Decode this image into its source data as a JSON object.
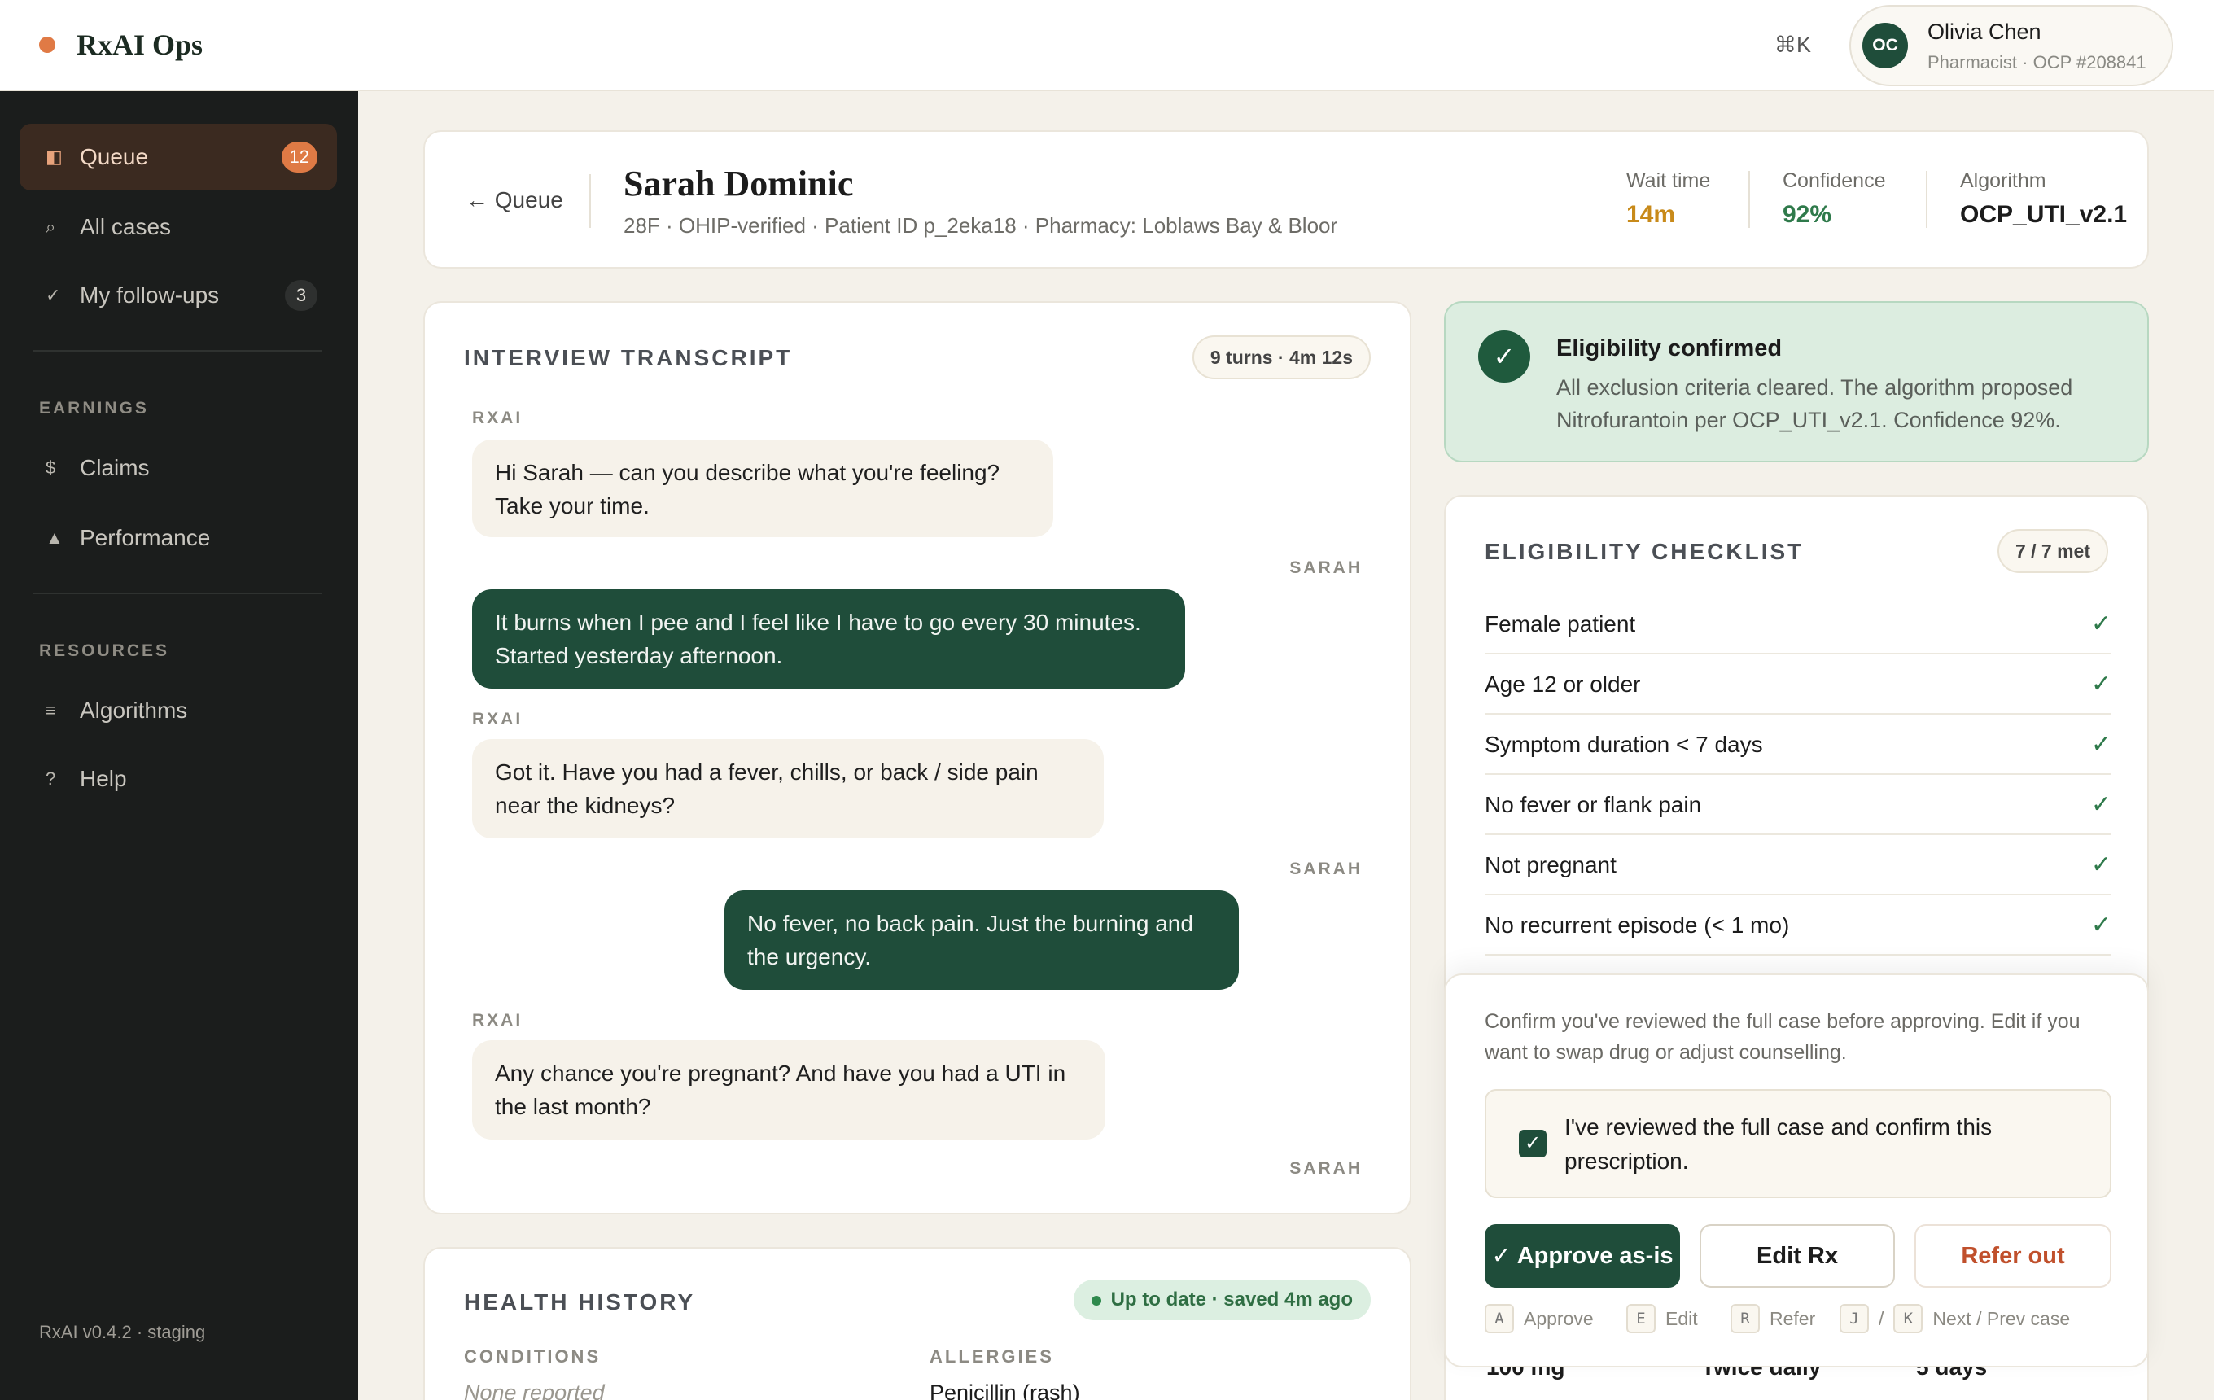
{
  "brand": {
    "name": "RxAI Ops"
  },
  "topbar": {
    "shortcut": "⌘K"
  },
  "user": {
    "initials": "OC",
    "name": "Olivia Chen",
    "role": "Pharmacist · OCP #208841"
  },
  "sidebar": {
    "items": [
      {
        "label": "Queue",
        "icon": "◧",
        "count": "12"
      },
      {
        "label": "All cases",
        "icon": "⌕"
      },
      {
        "label": "My follow-ups",
        "icon": "✓",
        "count": "3"
      }
    ],
    "earnings_title": "EARNINGS",
    "earnings": [
      {
        "label": "Claims",
        "icon": "$"
      },
      {
        "label": "Performance",
        "icon": "▲"
      }
    ],
    "resources_title": "RESOURCES",
    "resources": [
      {
        "label": "Algorithms",
        "icon": "≡"
      },
      {
        "label": "Help",
        "icon": "?"
      }
    ],
    "version": "RxAI v0.4.2 · staging"
  },
  "case": {
    "back_label": "← Queue",
    "patient_name": "Sarah Dominic",
    "patient_meta": "28F · OHIP-verified · Patient ID p_2eka18 · Pharmacy: Loblaws Bay & Bloor",
    "stats": {
      "wait_label": "Wait time",
      "wait_value": "14m",
      "confidence_label": "Confidence",
      "confidence_value": "92%",
      "algorithm_label": "Algorithm",
      "algorithm_value": "OCP_UTI_v2.1"
    },
    "colors": {
      "wait": "#c88a1a",
      "confidence": "#2f7a4b"
    }
  },
  "transcript": {
    "title": "INTERVIEW TRANSCRIPT",
    "summary": "9 turns · 4m 12s",
    "messages": [
      {
        "speaker": "RXAI",
        "text": "Hi Sarah — can you describe what you're feeling? Take your time."
      },
      {
        "speaker": "SARAH",
        "text": "It burns when I pee and I feel like I have to go every 30 minutes. Started yesterday afternoon."
      },
      {
        "speaker": "RXAI",
        "text": "Got it. Have you had a fever, chills, or back / side pain near the kidneys?"
      },
      {
        "speaker": "SARAH",
        "text": "No fever, no back pain. Just the burning and the urgency."
      },
      {
        "speaker": "RXAI",
        "text": "Any chance you're pregnant? And have you had a UTI in the last month?"
      },
      {
        "speaker": "SARAH",
        "text": ""
      }
    ]
  },
  "history": {
    "title": "HEALTH HISTORY",
    "status": "Up to date · saved 4m ago",
    "conditions_label": "CONDITIONS",
    "conditions_value": "None reported",
    "allergies_label": "ALLERGIES",
    "allergies_value": "Penicillin (rash)"
  },
  "eligibility": {
    "banner_title": "Eligibility confirmed",
    "banner_body": "All exclusion criteria cleared. The algorithm proposed Nitrofurantoin per OCP_UTI_v2.1. Confidence 92%.",
    "checklist_title": "ELIGIBILITY CHECKLIST",
    "checklist_count": "7 / 7 met",
    "items": [
      "Female patient",
      "Age 12 or older",
      "Symptom duration < 7 days",
      "No fever or flank pain",
      "Not pregnant",
      "No recurrent episode (< 1 mo)"
    ]
  },
  "review": {
    "note": "Confirm you've reviewed the full case before approving. Edit if you want to swap drug or adjust counselling.",
    "confirm_text": "I've reviewed the full case and confirm this prescription.",
    "approve_label": "✓ Approve as-is",
    "edit_label": "Edit Rx",
    "refer_label": "Refer out",
    "hints": [
      {
        "key": "A",
        "label": "Approve"
      },
      {
        "key": "E",
        "label": "Edit"
      },
      {
        "key": "R",
        "label": "Refer"
      }
    ],
    "nav_keys": [
      "J",
      "/",
      "K"
    ],
    "nav_label": "Next / Prev case"
  },
  "dose": {
    "strength": "100 mg",
    "frequency": "Twice daily",
    "duration": "5 days"
  }
}
